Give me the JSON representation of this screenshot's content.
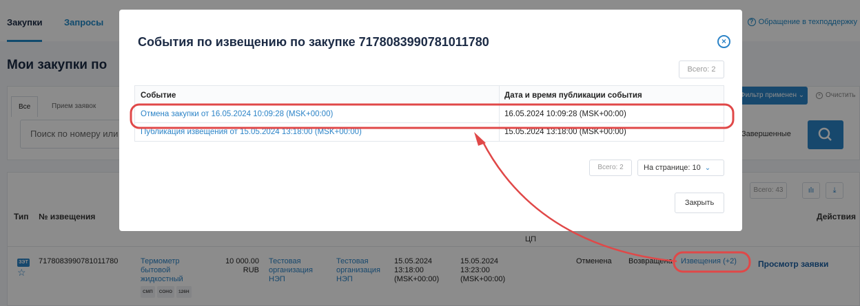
{
  "nav": {
    "tabs": [
      "Закупки",
      "Запросы"
    ],
    "support": "Обращение в техподдержку"
  },
  "page": {
    "title": "Мои закупки по",
    "filter_tabs": [
      "Все",
      "Прием заявок"
    ],
    "search_placeholder": "Поиск по номеру или",
    "filter_applied": "Фильтр применен",
    "clear": "Очистить",
    "completed": "Завершенные"
  },
  "table": {
    "total": "Всего: 43",
    "headers": {
      "type": "Тип",
      "number": "№ извещения",
      "actions": "Действия",
      "cp": "ЦП"
    },
    "row": {
      "type": "ЗЭТ",
      "number": "7178083990781011780",
      "name": [
        "Термометр",
        "бытовой",
        "жидкостный"
      ],
      "tags": [
        "СМП",
        "СОНО",
        "126Н"
      ],
      "price": "10 000.00",
      "currency": "RUB",
      "org1": [
        "Тестовая",
        "организация",
        "НЭП"
      ],
      "org2": [
        "Тестовая",
        "организация",
        "НЭП"
      ],
      "date1": [
        "15.05.2024",
        "13:18:00",
        "(MSK+00:00)"
      ],
      "date2": [
        "15.05.2024",
        "13:23:00",
        "(MSK+00:00)"
      ],
      "status": "Отменена",
      "status2": "Возвращена",
      "notices": "Извещения (+2)",
      "view": "Просмотр заявки"
    }
  },
  "modal": {
    "title": "События по извещению по закупке 7178083990781011780",
    "total_top": "Всего: 2",
    "col_event": "Событие",
    "col_date": "Дата и время публикации события",
    "events": [
      {
        "event": "Отмена закупки от 16.05.2024 10:09:28 (MSK+00:00)",
        "date": "16.05.2024 10:09:28 (MSK+00:00)"
      },
      {
        "event": "Публикация извещения от 15.05.2024 13:18:00 (MSK+00:00)",
        "date": "15.05.2024 13:18:00 (MSK+00:00)"
      }
    ],
    "total_bottom": "Всего: 2",
    "page_size": "На странице: 10",
    "close": "Закрыть"
  },
  "colors": {
    "accent": "#2b83c7",
    "annotation": "#e04848"
  }
}
